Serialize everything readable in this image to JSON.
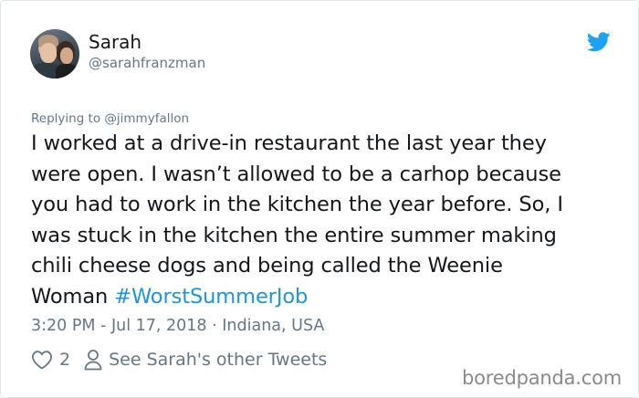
{
  "author": {
    "name": "Sarah",
    "handle": "@sarahfranzman"
  },
  "reply": {
    "prefix": "Replying to",
    "mention": "@jimmyfallon"
  },
  "tweet": {
    "lines": [
      "I worked at a drive-in restaurant the last year they",
      "were open. I wasn’t allowed to be a carhop because",
      "you had to work in the kitchen the year before. So, I",
      "was stuck in the kitchen the entire summer making",
      "chili cheese dogs and being called the Weenie"
    ],
    "last_line_text": "Woman ",
    "hashtag": "#WorstSummerJob"
  },
  "meta": {
    "time_date_location": "3:20 PM - Jul 17, 2018 · Indiana, USA"
  },
  "actions": {
    "like_count": "2",
    "other_tweets_label": "See Sarah's other Tweets"
  },
  "watermark": "boredpanda.com",
  "colors": {
    "link": "#1b95e0",
    "muted": "#657786",
    "twitter_blue": "#1da1f2"
  },
  "icons": {
    "platform": "twitter-bird-icon",
    "like": "heart-outline-icon",
    "profile": "person-outline-icon"
  }
}
